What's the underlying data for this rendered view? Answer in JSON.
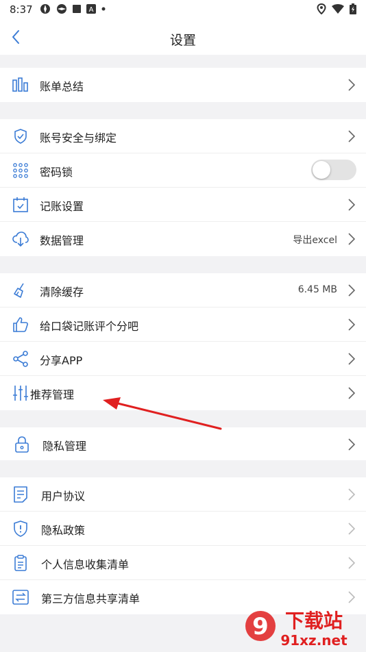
{
  "status_bar": {
    "time": "8:37"
  },
  "header": {
    "title": "设置"
  },
  "groups": [
    {
      "items": [
        {
          "label": "账单总结",
          "icon": "bar-chart-icon"
        }
      ]
    },
    {
      "items": [
        {
          "label": "账号安全与绑定",
          "icon": "shield-check-icon"
        },
        {
          "label": "密码锁",
          "icon": "keypad-icon",
          "toggle": false
        },
        {
          "label": "记账设置",
          "icon": "calendar-check-icon"
        },
        {
          "label": "数据管理",
          "icon": "cloud-download-icon",
          "value": "导出excel"
        }
      ]
    },
    {
      "items": [
        {
          "label": "清除缓存",
          "icon": "broom-icon",
          "value": "6.45 MB"
        },
        {
          "label": "给口袋记账评个分吧",
          "icon": "thumbs-up-icon"
        },
        {
          "label": "分享APP",
          "icon": "share-icon"
        },
        {
          "label": "推荐管理",
          "icon": "sliders-icon"
        }
      ]
    },
    {
      "items": [
        {
          "label": "隐私管理",
          "icon": "lock-icon"
        }
      ]
    },
    {
      "items": [
        {
          "label": "用户协议",
          "icon": "document-icon"
        },
        {
          "label": "隐私政策",
          "icon": "shield-info-icon"
        },
        {
          "label": "个人信息收集清单",
          "icon": "clipboard-icon"
        },
        {
          "label": "第三方信息共享清单",
          "icon": "exchange-icon"
        }
      ]
    }
  ],
  "watermark": {
    "number": "9",
    "text": "下载站",
    "url": "91xz.net"
  },
  "colors": {
    "accent": "#3a7bd5",
    "annotation_arrow": "#e02020",
    "background": "#f2f2f4"
  }
}
